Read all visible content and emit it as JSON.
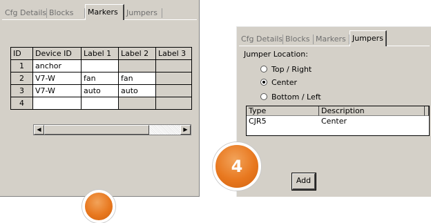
{
  "left_panel": {
    "tabs": [
      "Cfg Details",
      "Blocks",
      "Markers",
      "Jumpers"
    ],
    "active_tab": "Markers",
    "grid": {
      "columns": [
        "ID",
        "Device ID",
        "Label 1",
        "Label 2",
        "Label 3"
      ],
      "rows": [
        {
          "id": "1",
          "device_id": "anchor",
          "label1": "",
          "label2": "",
          "label3": ""
        },
        {
          "id": "2",
          "device_id": "V7-W",
          "label1": "fan",
          "label2": "fan",
          "label3": ""
        },
        {
          "id": "3",
          "device_id": "V7-W",
          "label1": "auto",
          "label2": "auto",
          "label3": ""
        },
        {
          "id": "4",
          "device_id": "",
          "label1": "",
          "label2": "",
          "label3": ""
        }
      ]
    },
    "scroll_left_glyph": "◀",
    "scroll_right_glyph": "▶"
  },
  "right_panel": {
    "tabs": [
      "Cfg Details",
      "Blocks",
      "Markers",
      "Jumpers"
    ],
    "active_tab": "Jumpers",
    "jumper_location_label": "Jumper Location:",
    "options": [
      {
        "label": "Top / Right",
        "selected": false
      },
      {
        "label": "Center",
        "selected": true
      },
      {
        "label": "Bottom / Left",
        "selected": false
      }
    ],
    "list": {
      "columns": [
        "Type",
        "Description"
      ],
      "rows": [
        {
          "type": "CJR5",
          "description": "Center"
        }
      ]
    },
    "add_button": "Add"
  },
  "badges": {
    "step_number": "4",
    "accent_color": "#e8781f"
  }
}
